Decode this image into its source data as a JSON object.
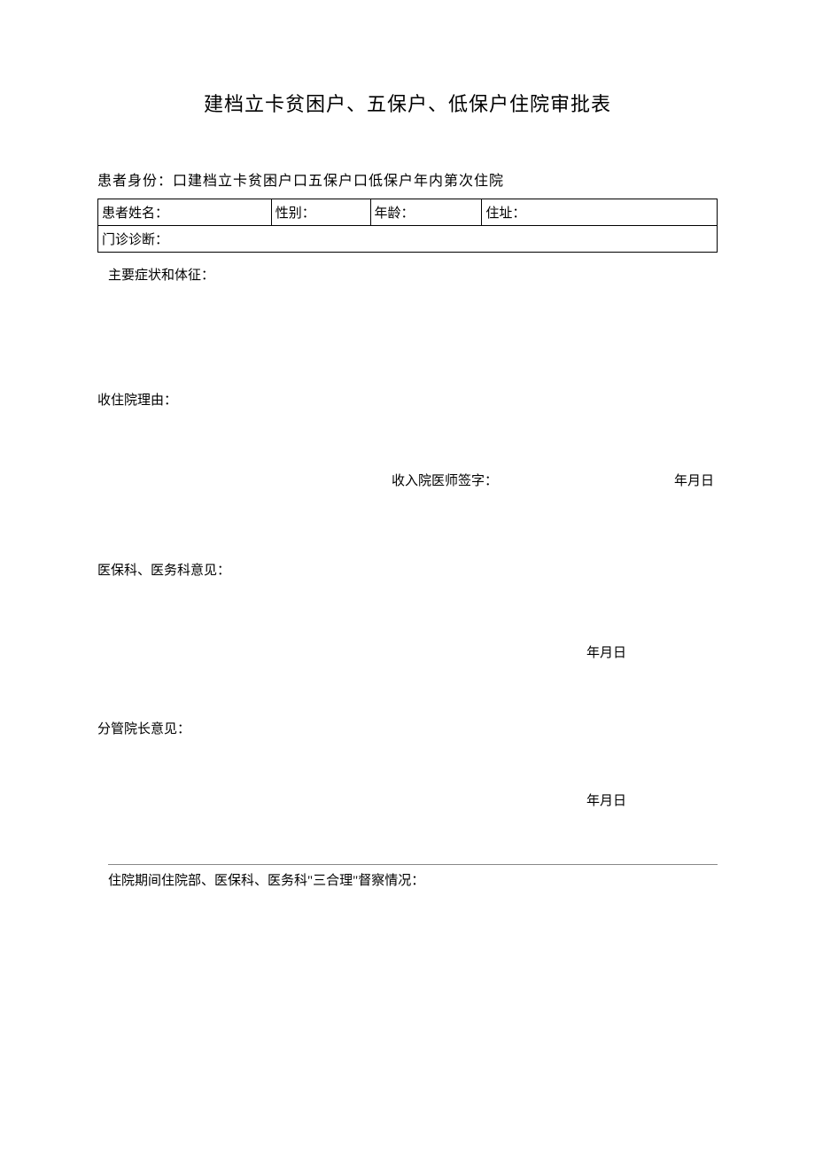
{
  "title": "建档立卡贫困户、五保户、低保户住院审批表",
  "identity_line": "患者身份：口建档立卡贫困户口五保户口低保户年内第次住院",
  "table": {
    "name_label": "患者姓名：",
    "gender_label": "性别：",
    "age_label": "年龄：",
    "address_label": "住址：",
    "diagnosis_label": "门诊诊断："
  },
  "sections": {
    "symptoms": "主要症状和体征：",
    "reason": "收住院理由：",
    "doctor_sign": "收入院医师签字：",
    "date_ymd": "年月日",
    "opinion1": "医保科、医务科意见：",
    "opinion2": "分管院长意见：",
    "supervise": "住院期间住院部、医保科、医务科\"三合理\"督察情况："
  }
}
